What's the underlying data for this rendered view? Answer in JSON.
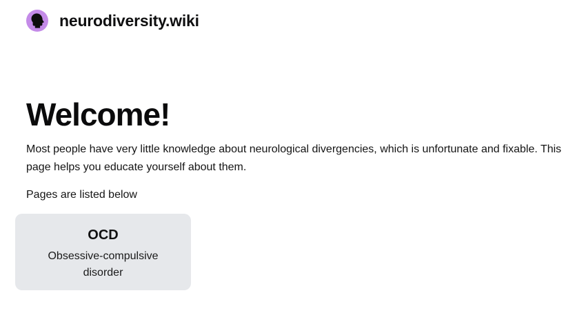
{
  "header": {
    "logo_icon": "head-silhouette-icon",
    "site_name": "neurodiversity.wiki"
  },
  "main": {
    "title": "Welcome!",
    "intro": "Most people have very little knowledge about neurological divergencies, which is unfortunate and fixable. This page helps you educate yourself about them.",
    "pages_label": "Pages are listed below"
  },
  "cards": [
    {
      "title": "OCD",
      "description": "Obsessive-compulsive disorder"
    }
  ],
  "colors": {
    "logo_background": "#c48be8",
    "card_background": "#e6e8eb",
    "text": "#111111"
  }
}
